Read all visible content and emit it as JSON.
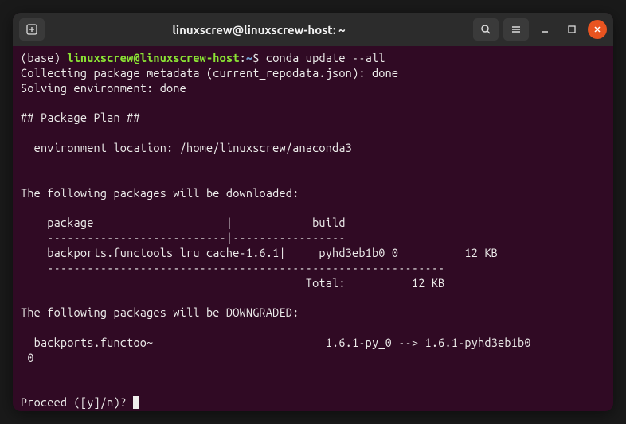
{
  "titlebar": {
    "title": "linuxscrew@linuxscrew-host: ~"
  },
  "prompt": {
    "base": "(base) ",
    "user": "linuxscrew",
    "at": "@",
    "host": "linuxscrew-host",
    "colon": ":",
    "path": "~",
    "dollar": "$ ",
    "command": "conda update --all"
  },
  "output": {
    "line1": "Collecting package metadata (current_repodata.json): done",
    "line2": "Solving environment: done",
    "blank1": "",
    "line3": "## Package Plan ##",
    "blank2": "",
    "line4": "  environment location: /home/linuxscrew/anaconda3",
    "blank3": "",
    "blank4": "",
    "line5": "The following packages will be downloaded:",
    "blank5": "",
    "line6": "    package                    |            build",
    "line7": "    ---------------------------|-----------------",
    "line8": "    backports.functools_lru_cache-1.6.1|     pyhd3eb1b0_0          12 KB",
    "line9": "    ------------------------------------------------------------",
    "line10": "                                           Total:          12 KB",
    "blank6": "",
    "line11": "The following packages will be DOWNGRADED:",
    "blank7": "",
    "line12": "  backports.functoo~                          1.6.1-py_0 --> 1.6.1-pyhd3eb1b0",
    "line13": "_0",
    "blank8": "",
    "blank9": "",
    "proceed": "Proceed ([y]/n)? "
  }
}
